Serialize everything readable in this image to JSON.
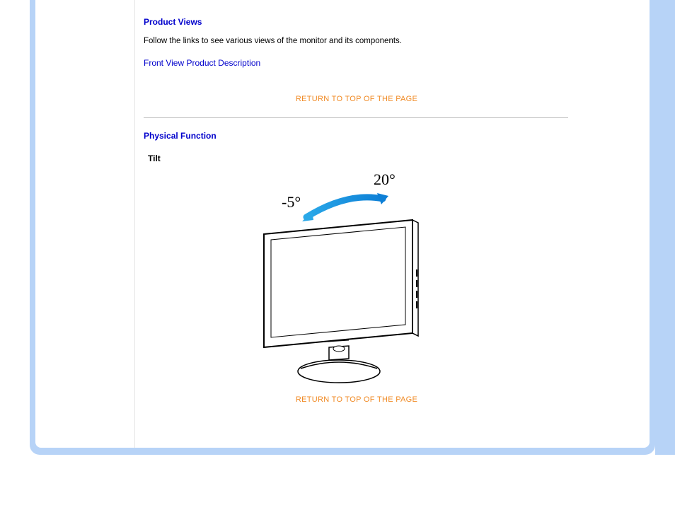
{
  "sections": {
    "productViews": {
      "heading": "Product Views",
      "body": "Follow the links to see various views of the monitor and its components.",
      "link": "Front View Product Description"
    },
    "physicalFunction": {
      "heading": "Physical Function",
      "sub": "Tilt",
      "angleNeg": "-5°",
      "anglePos": "20°"
    }
  },
  "returnLink": "RETURN TO TOP OF THE PAGE"
}
